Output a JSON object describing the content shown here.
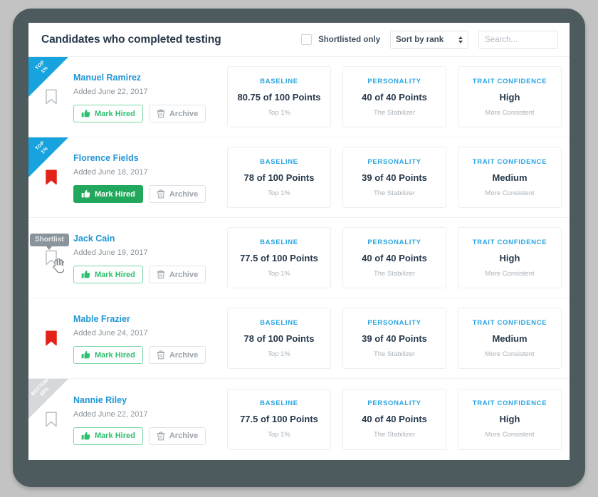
{
  "header": {
    "title": "Candidates who completed testing",
    "shortlisted_only_label": "Shortlisted only",
    "shortlisted_only_checked": false,
    "sort_select_value": "Sort by rank",
    "search_placeholder": "Search..."
  },
  "buttons": {
    "mark_hired_label": "Mark Hired",
    "archive_label": "Archive"
  },
  "tooltip": {
    "shortlist_label": "Shortlist"
  },
  "colors": {
    "accent_blue": "#2aa4e0",
    "name_blue": "#2196d6",
    "ribbon_blue": "#17a3dd",
    "ribbon_gray": "#d6d9db",
    "hire_green": "#2cbf6d",
    "hire_green_filled": "#22a85c",
    "bookmark_red": "#e2231a",
    "frame_gray": "#4d5a5e",
    "page_bg": "#c3c3c3"
  },
  "candidates": [
    {
      "name": "Manuel Ramirez",
      "added": "Added June 22, 2017",
      "ribbon_line1": "TOP",
      "ribbon_line2": "1%",
      "ribbon_style": "blue",
      "bookmark_state": "outline",
      "hire_state": "outline",
      "tooltip_visible": false,
      "stats": [
        {
          "label": "BASELINE",
          "value": "80.75 of 100 Points",
          "sub": "Top 1%"
        },
        {
          "label": "PERSONALITY",
          "value": "40 of 40 Points",
          "sub": "The Stabilizer"
        },
        {
          "label": "TRAIT CONFIDENCE",
          "value": "High",
          "sub": "More Consistent"
        }
      ]
    },
    {
      "name": "Florence Fields",
      "added": "Added June 18, 2017",
      "ribbon_line1": "TOP",
      "ribbon_line2": "1%",
      "ribbon_style": "blue",
      "bookmark_state": "filled",
      "hire_state": "filled",
      "tooltip_visible": false,
      "stats": [
        {
          "label": "BASELINE",
          "value": "78 of 100 Points",
          "sub": "Top 1%"
        },
        {
          "label": "PERSONALITY",
          "value": "39 of 40 Points",
          "sub": "The Stabilizer"
        },
        {
          "label": "TRAIT CONFIDENCE",
          "value": "Medium",
          "sub": "More Consistent"
        }
      ]
    },
    {
      "name": "Jack Cain",
      "added": "Added June 19, 2017",
      "ribbon_line1": "",
      "ribbon_line2": "",
      "ribbon_style": "none",
      "bookmark_state": "outline",
      "hire_state": "outline",
      "tooltip_visible": true,
      "stats": [
        {
          "label": "BASELINE",
          "value": "77.5 of 100 Points",
          "sub": "Top 1%"
        },
        {
          "label": "PERSONALITY",
          "value": "40 of 40 Points",
          "sub": "The Stabilizer"
        },
        {
          "label": "TRAIT CONFIDENCE",
          "value": "High",
          "sub": "More Consistent"
        }
      ]
    },
    {
      "name": "Mable Frazier",
      "added": "Added June 24, 2017",
      "ribbon_line1": "",
      "ribbon_line2": "",
      "ribbon_style": "none",
      "bookmark_state": "filled",
      "hire_state": "outline",
      "tooltip_visible": false,
      "stats": [
        {
          "label": "BASELINE",
          "value": "78 of 100 Points",
          "sub": "Top 1%"
        },
        {
          "label": "PERSONALITY",
          "value": "39 of 40 Points",
          "sub": "The Stabilizer"
        },
        {
          "label": "TRAIT CONFIDENCE",
          "value": "Medium",
          "sub": "More Consistent"
        }
      ]
    },
    {
      "name": "Nannie Riley",
      "added": "Added June 22, 2017",
      "ribbon_line1": "BOTTOM",
      "ribbon_line2": "50%",
      "ribbon_style": "gray",
      "bookmark_state": "outline",
      "hire_state": "outline",
      "tooltip_visible": false,
      "stats": [
        {
          "label": "BASELINE",
          "value": "77.5 of 100 Points",
          "sub": "Top 1%"
        },
        {
          "label": "PERSONALITY",
          "value": "40 of 40 Points",
          "sub": "The Stabilizer"
        },
        {
          "label": "TRAIT CONFIDENCE",
          "value": "High",
          "sub": "More Consistent"
        }
      ]
    }
  ]
}
